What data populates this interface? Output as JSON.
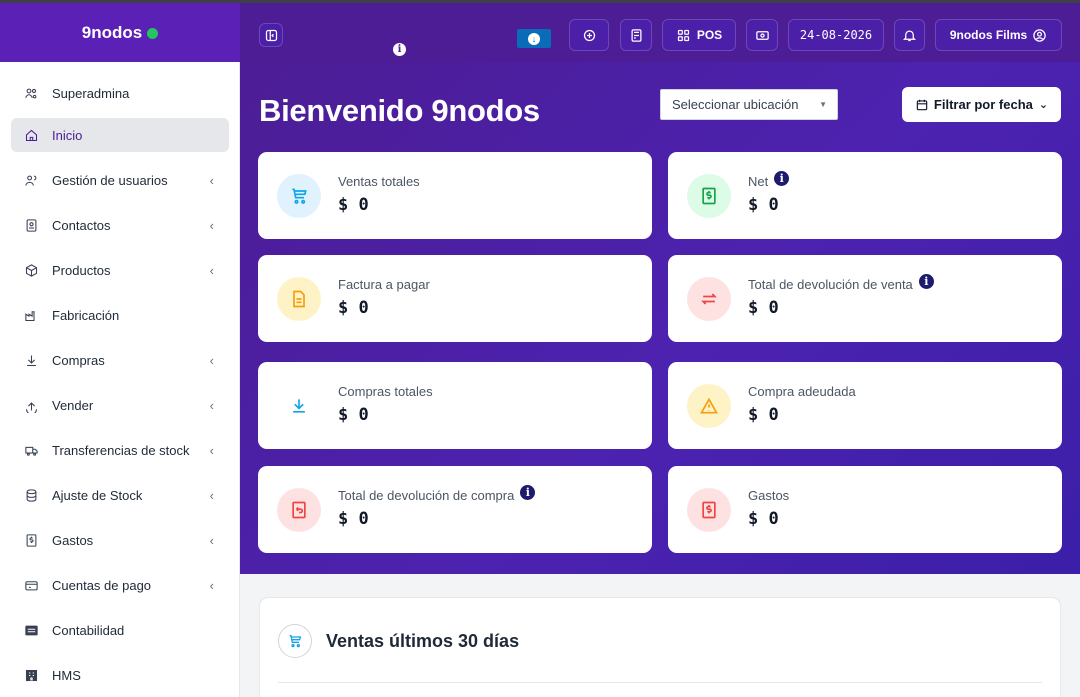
{
  "brand": {
    "name": "9nodos"
  },
  "topbar": {
    "info_icon": "i",
    "pos_label": "POS",
    "date": "24-08-2026",
    "user_label": "9nodos Films"
  },
  "sidebar": {
    "items": [
      {
        "label": "Superadmina",
        "icon": "users-cog-icon",
        "chevron": false
      },
      {
        "label": "Inicio",
        "icon": "home-icon",
        "chevron": false,
        "active": true
      },
      {
        "label": "Gestión de usuarios",
        "icon": "users-icon",
        "chevron": true
      },
      {
        "label": "Contactos",
        "icon": "contact-card-icon",
        "chevron": true
      },
      {
        "label": "Productos",
        "icon": "cube-icon",
        "chevron": true
      },
      {
        "label": "Fabricación",
        "icon": "factory-icon",
        "chevron": false
      },
      {
        "label": "Compras",
        "icon": "arrow-down-circle-icon",
        "chevron": true
      },
      {
        "label": "Vender",
        "icon": "arrow-up-circle-icon",
        "chevron": true
      },
      {
        "label": "Transferencias de stock",
        "icon": "truck-icon",
        "chevron": true
      },
      {
        "label": "Ajuste de Stock",
        "icon": "database-icon",
        "chevron": true
      },
      {
        "label": "Gastos",
        "icon": "dollar-receipt-icon",
        "chevron": true
      },
      {
        "label": "Cuentas de pago",
        "icon": "credit-card-icon",
        "chevron": true
      },
      {
        "label": "Contabilidad",
        "icon": "ledger-icon",
        "chevron": false
      },
      {
        "label": "HMS",
        "icon": "hotel-icon",
        "chevron": false
      }
    ]
  },
  "hero": {
    "title": "Bienvenido 9nodos",
    "location_placeholder": "Seleccionar ubicación",
    "date_filter_label": "Filtrar por fecha"
  },
  "cards": [
    {
      "label": "Ventas totales",
      "value": "$ 0",
      "icon": "cart-icon",
      "color": "#0ea5e9",
      "bg": "#e0f2fe",
      "info": false
    },
    {
      "label": "Net",
      "value": "$ 0",
      "icon": "money-receipt-icon",
      "color": "#16a34a",
      "bg": "#dcfce7",
      "info": true
    },
    {
      "label": "Factura a pagar",
      "value": "$ 0",
      "icon": "invoice-icon",
      "color": "#f59e0b",
      "bg": "#fef3c7",
      "info": false
    },
    {
      "label": "Total de devolución de venta",
      "value": "$ 0",
      "icon": "exchange-icon",
      "color": "#ef4444",
      "bg": "#fee2e2",
      "info": true
    },
    {
      "label": "Compras totales",
      "value": "$ 0",
      "icon": "download-icon",
      "color": "#0ea5e9",
      "bg": "#ffffff",
      "info": false
    },
    {
      "label": "Compra adeudada",
      "value": "$ 0",
      "icon": "warning-icon",
      "color": "#f59e0b",
      "bg": "#fef3c7",
      "info": false
    },
    {
      "label": "Total de devolución de compra",
      "value": "$ 0",
      "icon": "return-receipt-icon",
      "color": "#ef4444",
      "bg": "#fee2e2",
      "info": true
    },
    {
      "label": "Gastos",
      "value": "$ 0",
      "icon": "expense-receipt-icon",
      "color": "#ef4444",
      "bg": "#fee2e2",
      "info": false
    }
  ],
  "panel": {
    "title": "Ventas últimos 30 días"
  },
  "colors": {
    "primary": "#4c1d95",
    "online": "#22c55e",
    "download": "#0a6bb9"
  }
}
